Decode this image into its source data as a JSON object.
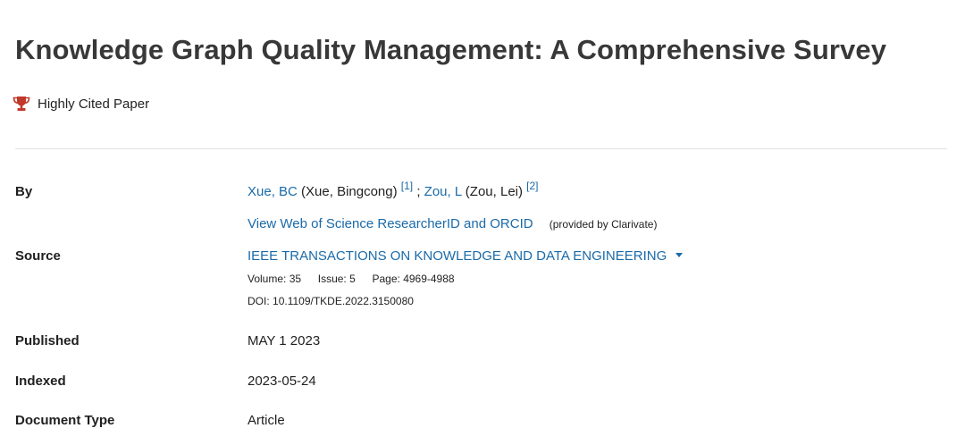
{
  "record": {
    "title": "Knowledge Graph Quality Management: A Comprehensive Survey",
    "badge": "Highly Cited Paper",
    "labels": {
      "by": "By",
      "source": "Source",
      "published": "Published",
      "indexed": "Indexed",
      "document_type": "Document Type"
    },
    "authors": [
      {
        "short": "Xue, BC",
        "full": "(Xue, Bingcong)",
        "affil": "[1]"
      },
      {
        "short": "Zou, L",
        "full": "(Zou, Lei)",
        "affil": "[2]"
      }
    ],
    "author_separator": ";",
    "researcher_link": "View Web of Science ResearcherID and ORCID",
    "researcher_note": "(provided by Clarivate)",
    "source": {
      "journal": "IEEE TRANSACTIONS ON KNOWLEDGE AND DATA ENGINEERING",
      "volume_label": "Volume:",
      "volume": "35",
      "issue_label": "Issue:",
      "issue": "5",
      "page_label": "Page:",
      "pages": "4969-4988",
      "doi_label": "DOI:",
      "doi": "10.1109/TKDE.2022.3150080"
    },
    "published": "MAY 1 2023",
    "indexed": "2023-05-24",
    "document_type": "Article"
  },
  "colors": {
    "link": "#1a6aa8",
    "trophy": "#c0392b"
  },
  "icons": {
    "badge_icon": "trophy-icon",
    "journal_expand": "caret-down-icon"
  }
}
